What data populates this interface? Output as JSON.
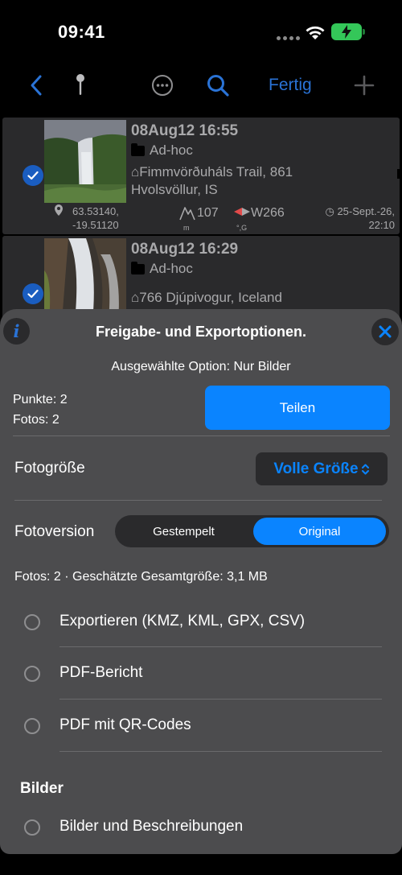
{
  "status": {
    "time": "09:41"
  },
  "toolbar": {
    "done_label": "Fertig"
  },
  "rows": [
    {
      "title": "08Aug12 16:55",
      "folder": "Ad-hoc",
      "address_line1": "⌂Fimmvörðuháls Trail, 861",
      "address_line2": "Hvolsvöllur, IS",
      "coord_lat": "63.53140,",
      "coord_lon": "-19.51120",
      "altitude": "107",
      "altitude_unit": "m",
      "heading": "W266",
      "heading_unit": "°,G",
      "date_line1": "◷ 25-Sept.-26,",
      "date_line2": "22:10"
    },
    {
      "title": "08Aug12 16:29",
      "folder": "Ad-hoc",
      "address_line1": "⌂766 Djúpivogur, Iceland"
    }
  ],
  "sheet": {
    "title": "Freigabe- und Exportoptionen.",
    "selected_option": "Ausgewählte Option: Nur Bilder",
    "points": "Punkte: 2",
    "photos": "Fotos: 2",
    "share_label": "Teilen",
    "photo_size_label": "Fotogröße",
    "photo_size_value": "Volle Größe",
    "photo_version_label": "Fotoversion",
    "version_options": [
      "Gestempelt",
      "Original"
    ],
    "version_selected": "Original",
    "estimate": "Fotos: 2 · Geschätzte Gesamtgröße: 3,1 MB",
    "options": [
      "Exportieren (KMZ, KML, GPX, CSV)",
      "PDF-Bericht",
      "PDF mit QR-Codes"
    ],
    "section_images": "Bilder",
    "images_options": [
      "Bilder und Beschreibungen"
    ]
  },
  "colors": {
    "accent": "#0a84ff",
    "toolbar_tint": "#2a73d6",
    "sheet_bg": "#4c4c4e",
    "row_bg": "#2a2a2c",
    "battery": "#34c759"
  },
  "icons": [
    "back-chevron-icon",
    "pin-icon",
    "more-icon",
    "search-icon",
    "plus-icon",
    "checkmark-icon",
    "folder-icon",
    "location-icon",
    "mountain-icon",
    "compass-icon",
    "info-icon",
    "close-icon",
    "updown-chevron-icon"
  ]
}
